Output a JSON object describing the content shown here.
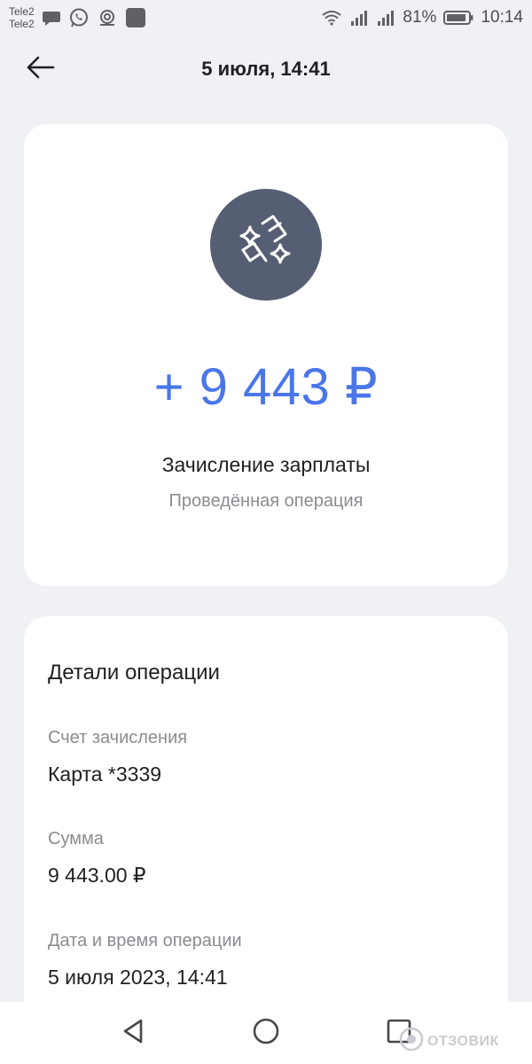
{
  "status_bar": {
    "carrier_1": "Tele2",
    "carrier_2": "Tele2",
    "battery_percent": "81%",
    "time": "10:14",
    "left_icons": [
      "chat-bubble-icon",
      "whatsapp-icon",
      "wireless-sync-icon",
      "app-square-icon"
    ],
    "right_icons": [
      "wifi-icon",
      "signal-icon",
      "signal-icon",
      "battery-icon"
    ]
  },
  "header": {
    "title": "5 июля, 14:41",
    "back_icon": "arrow-left-icon"
  },
  "summary": {
    "category_icon": "sparkle-wallet-icon",
    "amount": "+ 9 443 ₽",
    "title": "Зачисление зарплаты",
    "status": "Проведённая операция"
  },
  "details": {
    "heading": "Детали операции",
    "fields": [
      {
        "label": "Счет зачисления",
        "value": "Карта *3339"
      },
      {
        "label": "Сумма",
        "value": "9 443.00 ₽"
      },
      {
        "label": "Дата и время операции",
        "value": "5 июля 2023, 14:41"
      }
    ]
  },
  "nav_bar": {
    "icons": [
      "nav-back-icon",
      "nav-home-icon",
      "nav-recent-icon"
    ]
  },
  "watermark": {
    "text": "ОТЗОВИК"
  },
  "colors": {
    "background": "#eff1f4",
    "card": "#ffffff",
    "accent": "#4a76e8",
    "avatar": "#565e73",
    "secondary_text": "#8a8c91"
  }
}
